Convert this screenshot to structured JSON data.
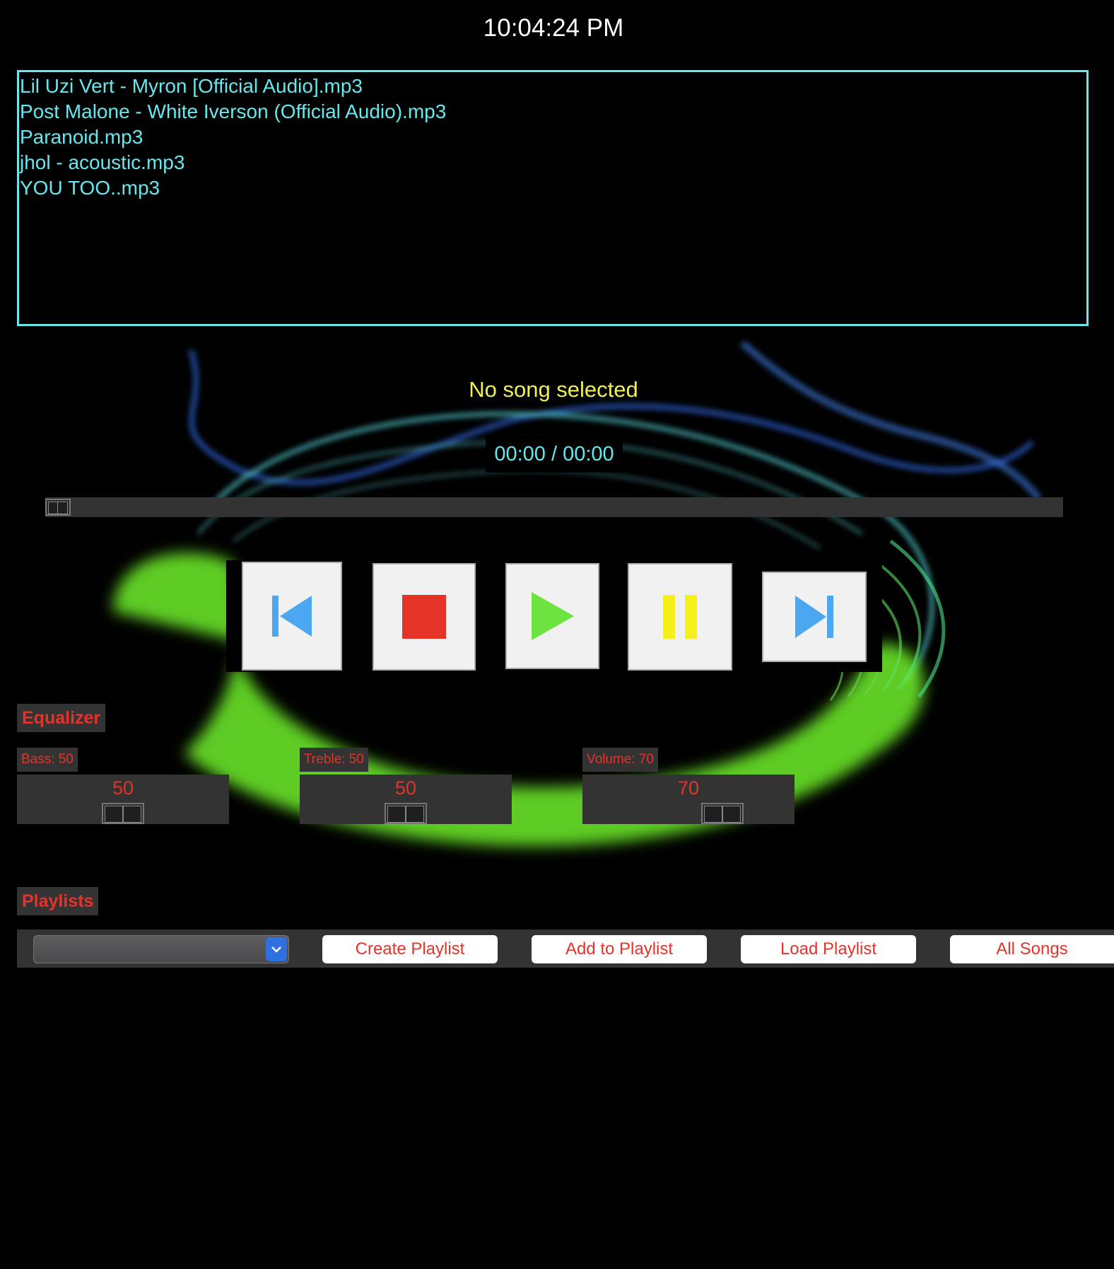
{
  "clock": "10:04:24 PM",
  "songs": [
    "Lil Uzi Vert - Myron [Official Audio].mp3",
    "Post Malone - White Iverson (Official Audio).mp3",
    "Paranoid.mp3",
    "jhol -  acoustic.mp3",
    "YOU TOO..mp3"
  ],
  "now_playing": "No song selected",
  "time_display": "00:00 / 00:00",
  "progress": 0,
  "controls": {
    "previous_icon": "skip-previous-icon",
    "stop_icon": "stop-icon",
    "play_icon": "play-icon",
    "pause_icon": "pause-icon",
    "next_icon": "skip-next-icon"
  },
  "equalizer": {
    "title": "Equalizer",
    "bass_label": "Bass: 50",
    "bass_value": "50",
    "treble_label": "Treble: 50",
    "treble_value": "50",
    "volume_label": "Volume: 70",
    "volume_value": "70"
  },
  "playlists": {
    "title": "Playlists",
    "selected": "",
    "create": "Create Playlist",
    "add": "Add to Playlist",
    "load": "Load Playlist",
    "all": "All Songs"
  },
  "colors": {
    "background": "#000000",
    "accent_cyan": "#66e8ee",
    "accent_red": "#e5332a",
    "accent_yellow": "#f1ef55",
    "play_green": "#6de33f",
    "nav_blue": "#4aa7f0"
  }
}
